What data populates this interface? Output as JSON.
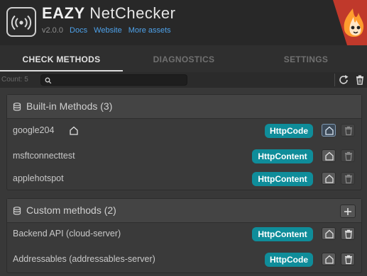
{
  "header": {
    "title_bold": "EAZY",
    "title_rest": " NetChecker",
    "version": "v2.0.0",
    "links": [
      "Docs",
      "Website",
      "More assets"
    ]
  },
  "tabs": [
    {
      "label": "CHECK METHODS",
      "active": true
    },
    {
      "label": "DIAGNOSTICS",
      "active": false
    },
    {
      "label": "SETTINGS",
      "active": false
    }
  ],
  "toolbar": {
    "count": "Count: 5",
    "search_value": ""
  },
  "builtin": {
    "title": "Built-in Methods (3)",
    "rows": [
      {
        "name": "google204",
        "badge": "HttpCode"
      },
      {
        "name": "msftconnecttest",
        "badge": "HttpContent"
      },
      {
        "name": "applehotspot",
        "badge": "HttpContent"
      }
    ]
  },
  "custom": {
    "title": "Custom methods (2)",
    "rows": [
      {
        "name": "Backend API (cloud-server)",
        "badge": "HttpContent"
      },
      {
        "name": "Addressables (addressables-server)",
        "badge": "HttpCode"
      }
    ]
  },
  "colors": {
    "badge": "#0f8d9a",
    "link": "#4ea2ea"
  }
}
